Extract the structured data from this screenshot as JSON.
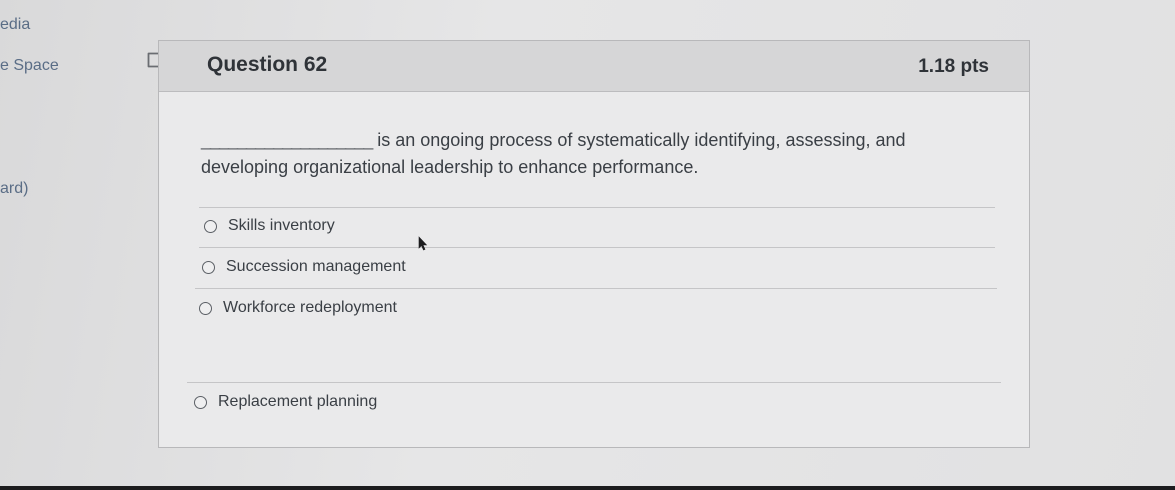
{
  "sidebar": {
    "items": [
      {
        "label": "edia"
      },
      {
        "label": "e Space"
      },
      {
        "label": "ard)"
      }
    ]
  },
  "question": {
    "title": "Question 62",
    "points": "1.18 pts",
    "blank": "___________________",
    "text_part1": "is an ongoing process of systematically identifying, assessing, and developing organizational leadership to enhance performance."
  },
  "answers": [
    {
      "label": "Skills inventory"
    },
    {
      "label": "Succession management"
    },
    {
      "label": "Workforce redeployment"
    },
    {
      "label": "Replacement planning"
    }
  ],
  "icons": {
    "flag": "flag-question-icon",
    "radio": "radio-button-icon",
    "cursor": "mouse-pointer-icon"
  }
}
